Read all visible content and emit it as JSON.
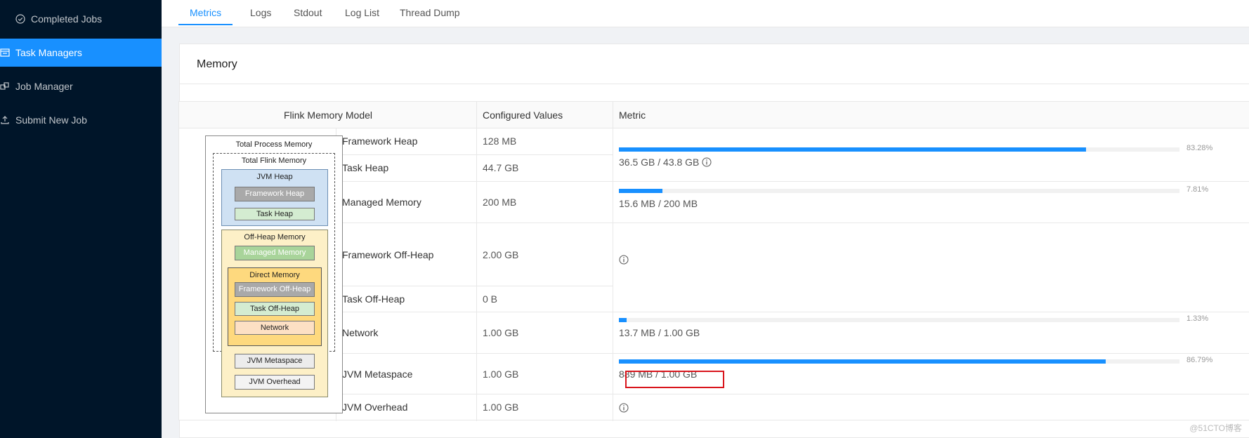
{
  "sidebar": {
    "items": [
      {
        "label": "Completed Jobs",
        "icon": "check-circle-icon",
        "active": false
      },
      {
        "label": "Task Managers",
        "icon": "task-managers-icon",
        "active": true
      },
      {
        "label": "Job Manager",
        "icon": "job-manager-icon",
        "active": false
      },
      {
        "label": "Submit New Job",
        "icon": "upload-icon",
        "active": false
      }
    ]
  },
  "tabs": [
    {
      "label": "Metrics",
      "active": true
    },
    {
      "label": "Logs",
      "active": false
    },
    {
      "label": "Stdout",
      "active": false
    },
    {
      "label": "Log List",
      "active": false
    },
    {
      "label": "Thread Dump",
      "active": false
    }
  ],
  "card": {
    "title": "Memory"
  },
  "table": {
    "headers": {
      "model": "Flink Memory Model",
      "configured": "Configured Values",
      "metric": "Metric"
    },
    "rows": [
      {
        "name": "Framework Heap",
        "value": "128 MB"
      },
      {
        "name": "Task Heap",
        "value": "44.7 GB"
      },
      {
        "name": "Managed Memory",
        "value": "200 MB"
      },
      {
        "name": "Framework Off-Heap",
        "value": "2.00 GB"
      },
      {
        "name": "Task Off-Heap",
        "value": "0 B"
      },
      {
        "name": "Network",
        "value": "1.00 GB"
      },
      {
        "name": "JVM Metaspace",
        "value": "1.00 GB"
      },
      {
        "name": "JVM Overhead",
        "value": "1.00 GB"
      }
    ],
    "metrics": [
      {
        "pct_label": "83.28%",
        "fraction": 0.8328,
        "text": "36.5 GB / 43.8 GB",
        "info": true
      },
      {
        "pct_label": "7.81%",
        "fraction": 0.0781,
        "text": "15.6 MB / 200 MB",
        "info": false
      },
      {
        "pct_label": "1.33%",
        "fraction": 0.0133,
        "text": "13.7 MB / 1.00 GB",
        "info": false
      },
      {
        "pct_label": "86.79%",
        "fraction": 0.8679,
        "text": "889 MB / 1.00 GB",
        "info": false
      }
    ]
  },
  "diagram": {
    "total_process": "Total Process Memory",
    "total_flink": "Total Flink Memory",
    "jvm_heap": "JVM Heap",
    "framework_heap": "Framework Heap",
    "task_heap": "Task Heap",
    "off_heap": "Off-Heap Memory",
    "managed_memory": "Managed Memory",
    "direct_memory": "Direct Memory",
    "framework_off_heap": "Framework Off-Heap",
    "task_off_heap": "Task Off-Heap",
    "network": "Network",
    "jvm_metaspace": "JVM Metaspace",
    "jvm_overhead": "JVM Overhead"
  },
  "watermark": "@51CTO博客",
  "colors": {
    "sidebar_bg": "#001529",
    "accent": "#1890ff",
    "highlight": "#d9151c"
  }
}
